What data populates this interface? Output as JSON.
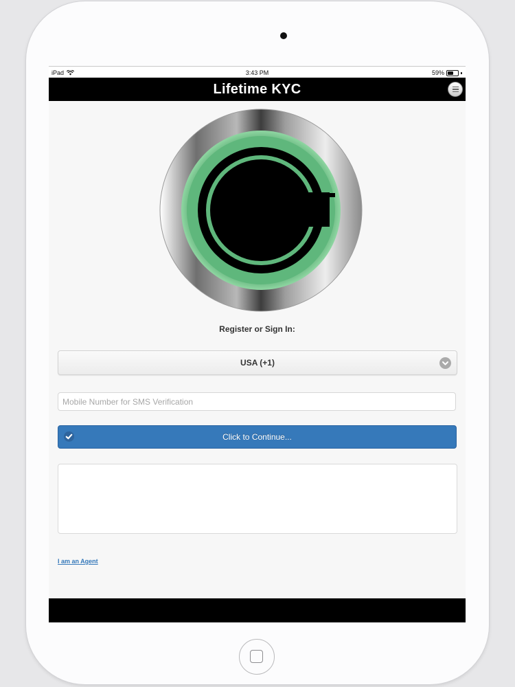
{
  "status_bar": {
    "carrier": "iPad",
    "time": "3:43 PM",
    "battery": "59%",
    "battery_level": 0.59
  },
  "header": {
    "title": "Lifetime KYC"
  },
  "login": {
    "prompt": "Register or Sign In:",
    "country_selected": "USA (+1)",
    "mobile_placeholder": "Mobile Number for SMS Verification",
    "mobile_value": "",
    "continue_label": "Click to Continue...",
    "agent_link": "I am an Agent"
  },
  "colors": {
    "accent": "#3679ba",
    "logo_ring": "#5fb77c",
    "header_bg": "#000000"
  },
  "icons": {
    "wifi": "wifi-icon",
    "menu": "menu-icon",
    "check": "check-icon",
    "chevron": "chevron-down-icon",
    "home": "home-button"
  }
}
